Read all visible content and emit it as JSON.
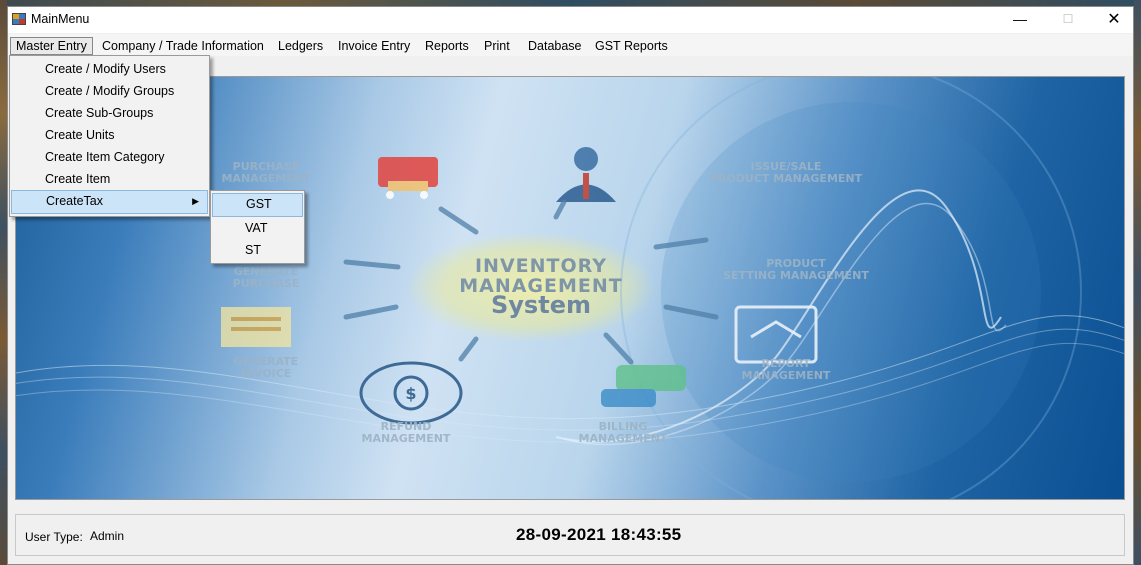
{
  "window": {
    "title": "MainMenu",
    "controls": {
      "minimize": "—",
      "maximize": "☐",
      "close": "✕"
    }
  },
  "menubar": {
    "items": [
      {
        "label": "Master Entry"
      },
      {
        "label": "Company / Trade Information"
      },
      {
        "label": "Ledgers"
      },
      {
        "label": "Invoice Entry"
      },
      {
        "label": "Reports"
      },
      {
        "label": "Print"
      },
      {
        "label": "Database"
      },
      {
        "label": "GST Reports"
      }
    ]
  },
  "dropdown": {
    "items": [
      {
        "label": "Create / Modify Users"
      },
      {
        "label": "Create  / Modify Groups"
      },
      {
        "label": "Create Sub-Groups"
      },
      {
        "label": "Create Units"
      },
      {
        "label": "Create Item Category"
      },
      {
        "label": "Create Item"
      },
      {
        "label": "CreateTax",
        "submenu_arrow": "▶"
      }
    ]
  },
  "submenu": {
    "items": [
      {
        "label": "GST"
      },
      {
        "label": "VAT"
      },
      {
        "label": "ST"
      }
    ]
  },
  "background_image": {
    "center_line1": "INVENTORY",
    "center_line2": "MANAGEMENT",
    "center_line3": "System",
    "labels": [
      "PURCHASE",
      "MANAGEMENT",
      "ISSUE/SALE",
      "PRODUCT MANAGEMENT",
      "GENERATE",
      "PURCHASE",
      "PRODUCT",
      "SETTING MANAGEMENT",
      "GENERATE",
      "INVOICE",
      "REPORT",
      "MANAGEMENT",
      "REFUND",
      "MANAGEMENT",
      "BILLING",
      "MANAGEMENT"
    ]
  },
  "status": {
    "user_type_label": "User Type:",
    "user_type_value": "Admin",
    "datetime": "28-09-2021 18:43:55"
  },
  "colors": {
    "highlight": "#cce4f7",
    "highlight_border": "#8cb7de",
    "canvas_dark": "#0a4f92",
    "canvas_light": "#cfe2f3"
  }
}
